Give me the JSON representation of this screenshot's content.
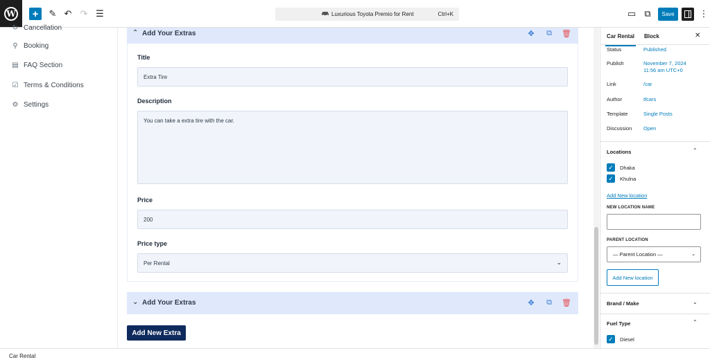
{
  "topbar": {
    "logo_letter": "W",
    "add_label": "+",
    "pen_icon": "✎",
    "undo_icon": "↶",
    "redo_icon": "↷",
    "list_icon": "☰",
    "doc_title": "Luxurious Toyota Premio for Rent",
    "shortcut": "Ctrl+K",
    "view_icon": "▭",
    "external_icon": "⧉",
    "save_label": "Save",
    "more_icon": "⋮"
  },
  "leftnav": {
    "items": [
      {
        "label": "Cancellation",
        "icon": "↻"
      },
      {
        "label": "Booking",
        "icon": "⚲"
      },
      {
        "label": "FAQ Section",
        "icon": "▤"
      },
      {
        "label": "Terms & Conditions",
        "icon": "☑"
      },
      {
        "label": "Settings",
        "icon": "⚙"
      }
    ]
  },
  "editor": {
    "block1": {
      "title": "Add Your Extras",
      "chevron": "⌃",
      "fields": {
        "title_label": "Title",
        "title_value": "Extra Tire",
        "description_label": "Description",
        "description_value": "You can take a extra tire with the car.",
        "price_label": "Price",
        "price_value": "200",
        "price_type_label": "Price type",
        "price_type_value": "Per Rental"
      }
    },
    "block2": {
      "title": "Add Your Extras",
      "chevron": "⌄"
    },
    "move_icon": "✥",
    "copy_icon": "⧉",
    "delete_icon": "🗑",
    "select_chevron": "⌄",
    "add_new_extra": "Add New Extra"
  },
  "sidebar": {
    "tabs": [
      "Car Rental",
      "Block"
    ],
    "close": "✕",
    "post": {
      "status_key": "Status",
      "status_val": "Published",
      "publish_key": "Publish",
      "publish_val": "November 7, 2024 11:56 am UTC+0",
      "link_key": "Link",
      "link_val": "/car",
      "author_key": "Author",
      "author_val": "tfcars",
      "template_key": "Template",
      "template_val": "Single Posts",
      "discussion_key": "Discussion",
      "discussion_val": "Open"
    },
    "locations": {
      "heading": "Locations",
      "chevron": "⌃",
      "items": [
        "Dhaka",
        "Khulna"
      ],
      "add_link": "Add New location",
      "new_name_caption": "NEW LOCATION NAME",
      "parent_caption": "PARENT LOCATION",
      "parent_select": "— Parent Location —",
      "add_button": "Add New location"
    },
    "brand": {
      "heading": "Brand / Make",
      "chevron": "⌄"
    },
    "fuel": {
      "heading": "Fuel Type",
      "chevron": "⌃",
      "items": [
        "Diesel"
      ]
    },
    "check": "✓",
    "select_chev": "⌄"
  },
  "footer": {
    "breadcrumb": "Car Rental"
  },
  "colors": {
    "accent": "#007cba",
    "block_header": "#dfe9fb",
    "primary_button": "#0f2a5c",
    "delete": "#e65054"
  }
}
